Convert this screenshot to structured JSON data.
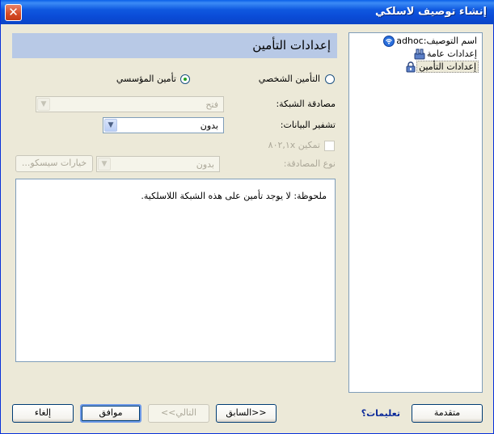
{
  "window": {
    "title": "إنشاء توصيف لاسلكي",
    "close_glyph": "✕"
  },
  "tree": {
    "items": [
      {
        "prefix": "اسم التوصيف:",
        "value": "adhoc",
        "icon": "wifi-icon"
      },
      {
        "label": "إعدادات عامة",
        "icon": "network-settings-icon"
      },
      {
        "label": "إعدادات التأمين",
        "icon": "security-lock-icon",
        "selected": true
      }
    ]
  },
  "header": {
    "title": "إعدادات التأمين"
  },
  "security": {
    "personal_label": "التأمين الشخصي",
    "enterprise_label": "تأمين المؤسسي",
    "selected": "enterprise",
    "network_auth_label": "مصادقة الشبكة:",
    "network_auth_value": "فتح",
    "data_encryption_label": "تشفير البيانات:",
    "data_encryption_value": "بدون",
    "enable_8021x_label": "تمكين ٨٠٢,١x",
    "auth_type_label": "نوع المصادقة:",
    "auth_type_value": "بدون",
    "cisco_options_label": "خيارات سيسكو..."
  },
  "note": {
    "text": "ملحوظة: لا يوجد تأمين على هذه الشبكة اللاسلكية."
  },
  "footer": {
    "advanced_label": "متقدمة",
    "help_label": "تعليمات؟",
    "back_label": "<<السابق",
    "next_label": "التالي>>",
    "ok_label": "موافق",
    "cancel_label": "إلغاء"
  },
  "colors": {
    "title_bar": "#0a4bd6",
    "header_band": "#b8c9e6",
    "dialog_bg": "#ece9d8",
    "radio_dot": "#21a121"
  }
}
